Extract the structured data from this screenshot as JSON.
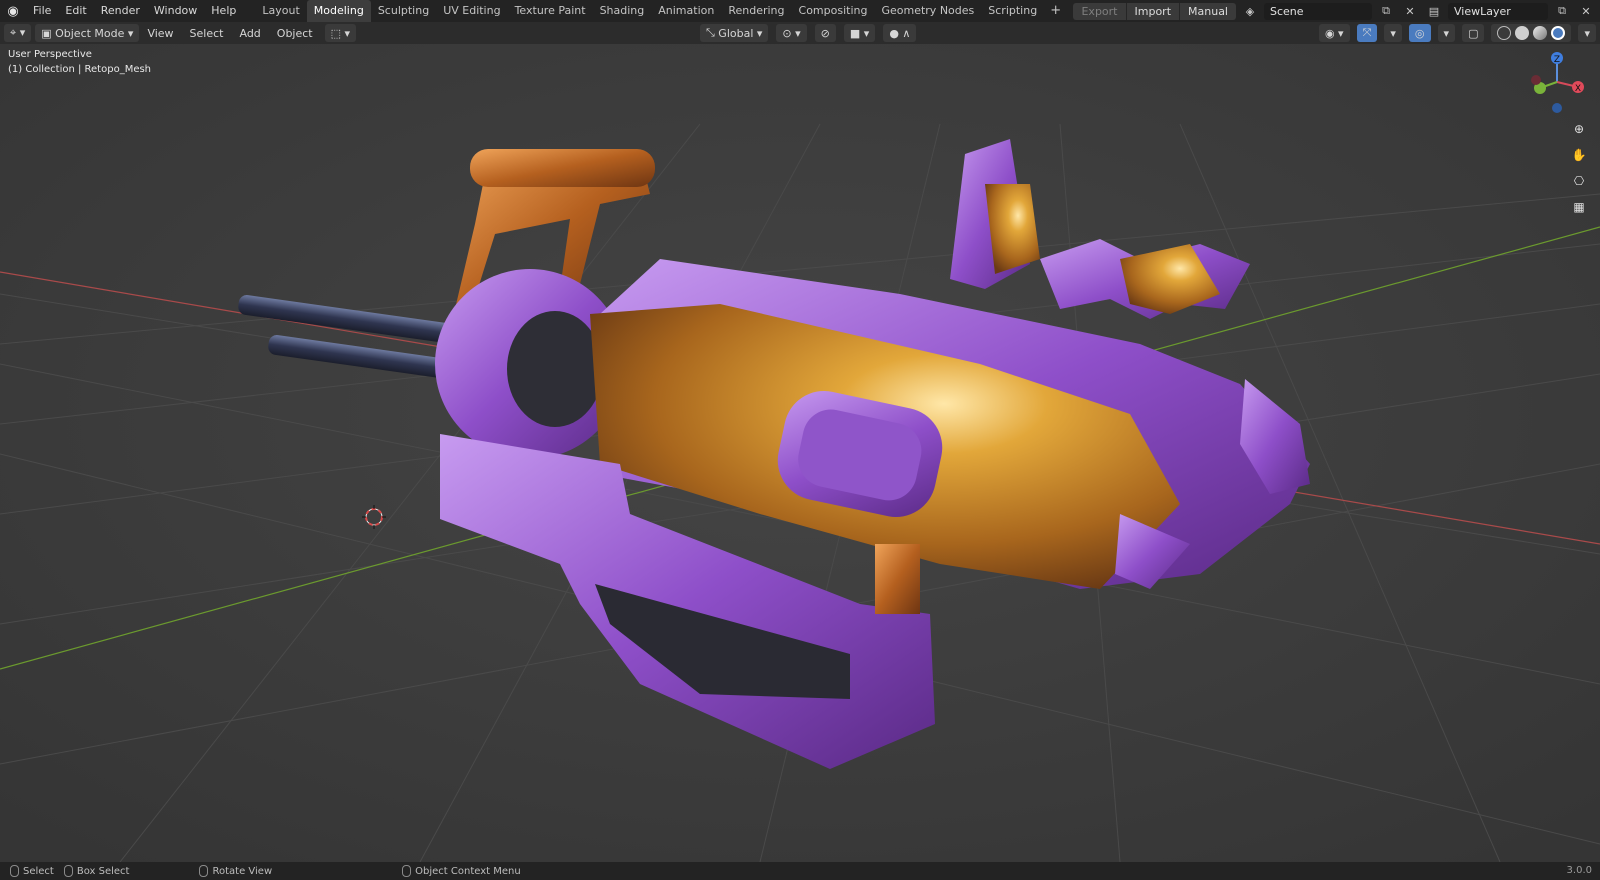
{
  "menu": [
    "File",
    "Edit",
    "Render",
    "Window",
    "Help"
  ],
  "workspaces": {
    "tabs": [
      "Layout",
      "Modeling",
      "Sculpting",
      "UV Editing",
      "Texture Paint",
      "Shading",
      "Animation",
      "Rendering",
      "Compositing",
      "Geometry Nodes",
      "Scripting"
    ],
    "active": "Modeling",
    "add_label": "+"
  },
  "top_right": {
    "export": "Export",
    "import": "Import",
    "manual": "Manual",
    "scene": "Scene",
    "view_layer": "ViewLayer"
  },
  "viewport_header": {
    "mode": "Object Mode",
    "menus": [
      "View",
      "Select",
      "Add",
      "Object"
    ],
    "orientation": "Global"
  },
  "viewport": {
    "perspective": "User Perspective",
    "collection": "(1) Collection | Retopo_Mesh",
    "gizmo_z": "Z",
    "gizmo_x": "X"
  },
  "statusbar": {
    "select": "Select",
    "box_select": "Box Select",
    "rotate_view": "Rotate View",
    "context_menu": "Object Context Menu",
    "version": "3.0.0"
  },
  "colors": {
    "purple": "#9b5fd6",
    "orange": "#c97a2a",
    "gold": "#d69a2e",
    "active_blue": "#4a7bbf"
  }
}
